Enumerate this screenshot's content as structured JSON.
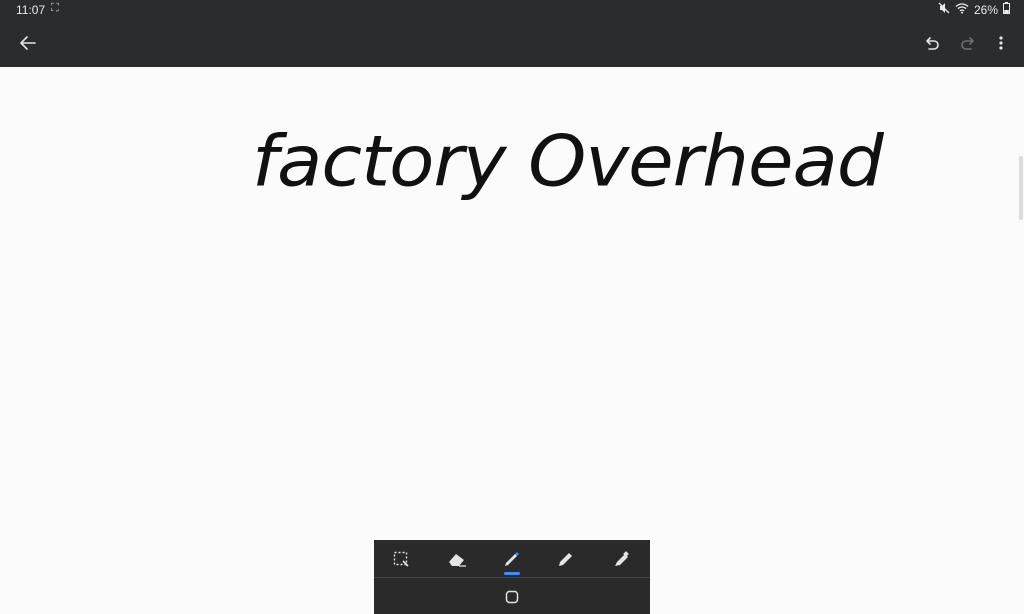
{
  "status_bar": {
    "time": "11:07",
    "screenshot_glyph": "⛶",
    "battery": "26%",
    "icons": [
      "mute-icon",
      "wifi-icon",
      "battery-icon"
    ]
  },
  "toolbar_top": {
    "icons": [
      "back-arrow-icon",
      "undo-icon",
      "redo-icon",
      "more-vert-icon"
    ]
  },
  "note": {
    "handwriting": "factory Overhead",
    "ink_color": "#111111"
  },
  "pen_toolbar": {
    "tools": [
      "selection-icon",
      "eraser-icon",
      "fountain-pen-icon",
      "pencil-icon",
      "highlighter-icon"
    ],
    "active_tool": "fountain-pen-icon",
    "active_color": "#3d8bfd"
  },
  "colors": {
    "bar_bg": "#2b2c2e",
    "canvas_bg": "#fbfbfb"
  }
}
